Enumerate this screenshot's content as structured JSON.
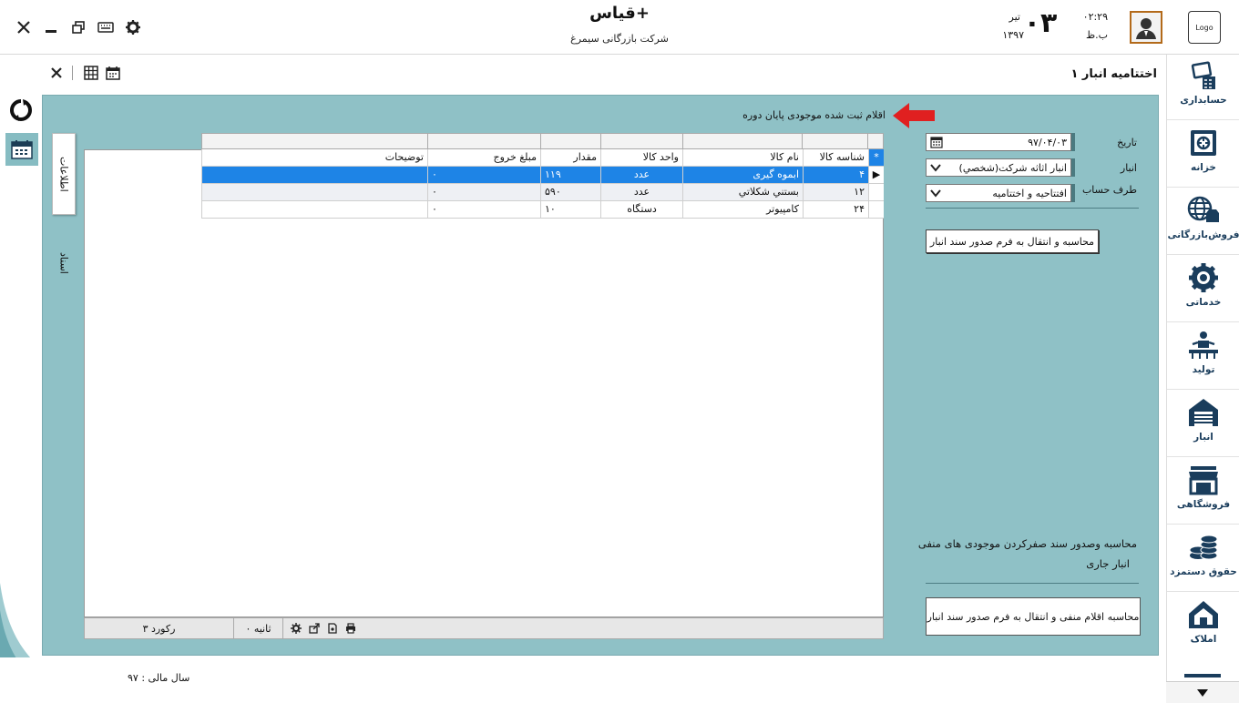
{
  "header": {
    "app_title": "قیاس+",
    "company": "شرکت بازرگانی سیمرغ",
    "logo": "Logo",
    "clock_time": "۰۲:۲۹",
    "clock_ampm": "ب.ظ",
    "date_day": "۰۳",
    "date_month": "تیر",
    "date_year": "۱۳۹۷"
  },
  "form": {
    "title": "اختتامیه انبار ۱",
    "grid_note": "اقلام ثبت شده موجودی پایان دوره",
    "date_label": "تاریخ",
    "date_value": "۹۷/۰۴/۰۳",
    "warehouse_label": "انبار",
    "warehouse_value": "انبار اثاثه شرکت(شخصي)",
    "account_label": "طرف حساب",
    "account_value": "افتتاحیه و اختتامیه",
    "calc_button": "محاسبه و انتقال به فرم صدور سند انبار",
    "section_text_line1": "محاسبه وصدور سند صفرکردن موجودی های منفی",
    "section_text_line2": "انبار جاری",
    "negative_button": "محاسبه اقلام منفی و انتقال به فرم صدور سند انبار"
  },
  "tabs": {
    "info": "اطلاعات",
    "docs": "اسناد"
  },
  "grid": {
    "columns": [
      "شناسه کالا",
      "نام کالا",
      "واحد کالا",
      "مقدار",
      "مبلغ خروج",
      "توضیحات"
    ],
    "header_marker": "*",
    "row_marker": "▶",
    "rows": [
      {
        "id": "۴",
        "name": "ابموه گیری",
        "unit": "عدد",
        "qty": "۱۱۹",
        "amount": "۰",
        "desc": ""
      },
      {
        "id": "۱۲",
        "name": "بستني شكلاتي",
        "unit": "عدد",
        "qty": "۵۹۰",
        "amount": "۰",
        "desc": ""
      },
      {
        "id": "۲۴",
        "name": "كامپيوتر",
        "unit": "دستگاه",
        "qty": "۱۰",
        "amount": "۰",
        "desc": ""
      }
    ],
    "footer_records": "۳ رکورد",
    "footer_timer": "۰ ثانیه"
  },
  "status": {
    "fiscal_year": "سال مالی : ۹۷"
  },
  "nav": {
    "items": [
      {
        "label": "حسابداری",
        "icon": "accounting-icon"
      },
      {
        "label": "خزانه",
        "icon": "treasury-safe-icon"
      },
      {
        "label": "فروش‌بازرگانی",
        "icon": "commerce-globe-icon"
      },
      {
        "label": "خدماتی",
        "icon": "services-gear-icon"
      },
      {
        "label": "تولید",
        "icon": "production-worker-icon"
      },
      {
        "label": "انبار",
        "icon": "warehouse-icon"
      },
      {
        "label": "فروشگاهی",
        "icon": "store-icon"
      },
      {
        "label": "حقوق دستمزد",
        "icon": "payroll-coins-icon"
      },
      {
        "label": "املاک",
        "icon": "real-estate-icon"
      }
    ]
  },
  "colors": {
    "panel": "#8fc1c6",
    "selected_row": "#1e84e6",
    "nav_text": "#1a3d5c",
    "arrow": "#e02020"
  }
}
